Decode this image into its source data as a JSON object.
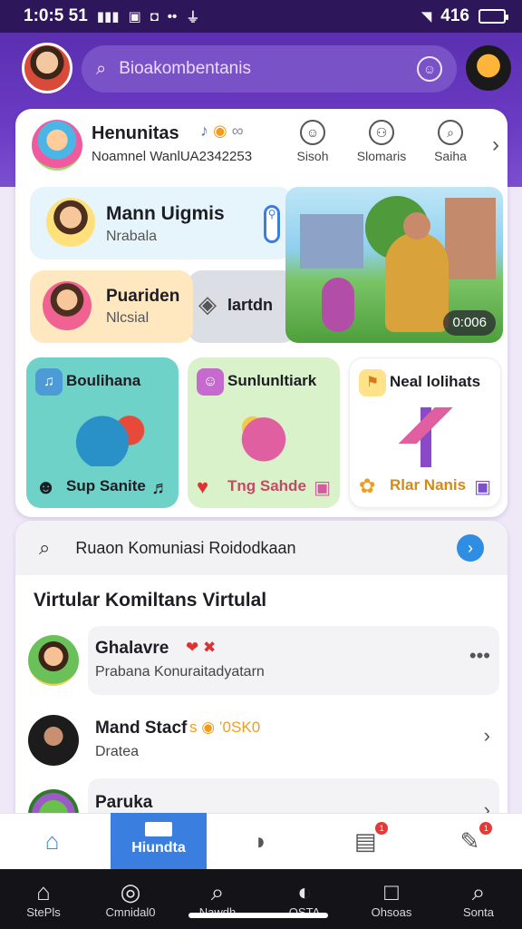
{
  "status_bar": {
    "time": "1:0:5 51",
    "battery_level": 0.8,
    "battery_text": "416"
  },
  "header": {
    "search_text": "Bioakombentanis"
  },
  "community": {
    "title": "Henunitas",
    "subtitle": "Noamnel WanlUA2342253",
    "quick_actions": [
      {
        "label": "Sisoh",
        "icon": "chat-icon"
      },
      {
        "label": "Slomaris",
        "icon": "people-icon"
      },
      {
        "label": "Saiha",
        "icon": "search-icon"
      }
    ]
  },
  "tiles": {
    "main": {
      "title": "Mann Uigmis",
      "subtitle": "Nrabala"
    },
    "program": {
      "title": "Puariden",
      "subtitle": "Nlcsial"
    },
    "location": {
      "title": "Iartdn"
    },
    "video": {
      "duration": "0:006"
    }
  },
  "big_tiles": [
    {
      "title": "Boulihana",
      "footer": "Sup Sanite"
    },
    {
      "title": "Sunlunltiark",
      "footer": "Tng Sahde"
    },
    {
      "title": "Neal lolihats",
      "footer": "Rlar Nanis"
    }
  ],
  "feed": {
    "search_text": "Ruaon Komuniasi Roidodkaan",
    "section_title": "Virtular Komiltans Virtulal",
    "items": [
      {
        "name": "Ghalavre",
        "subtitle": "Prabana Konuraitadyatarn",
        "meta": "❤ ✖"
      },
      {
        "name": "Mand Stacf",
        "subtitle": "Dratea",
        "meta": "s ◉ ’0SK0"
      },
      {
        "name": "Paruka",
        "subtitle": "",
        "meta": ""
      }
    ]
  },
  "bottom_nav": {
    "active_label": "Hiundta",
    "badge_1": "1",
    "badge_2": "1"
  },
  "system_nav": [
    {
      "label": "StePls",
      "icon": "home-outline-icon"
    },
    {
      "label": "Cmnidal0",
      "icon": "target-icon"
    },
    {
      "label": "Nawdh",
      "icon": "search-icon"
    },
    {
      "label": "OSTA",
      "icon": "compass-icon"
    },
    {
      "label": "Ohsoas",
      "icon": "square-icon"
    },
    {
      "label": "Sonta",
      "icon": "search-icon"
    }
  ]
}
